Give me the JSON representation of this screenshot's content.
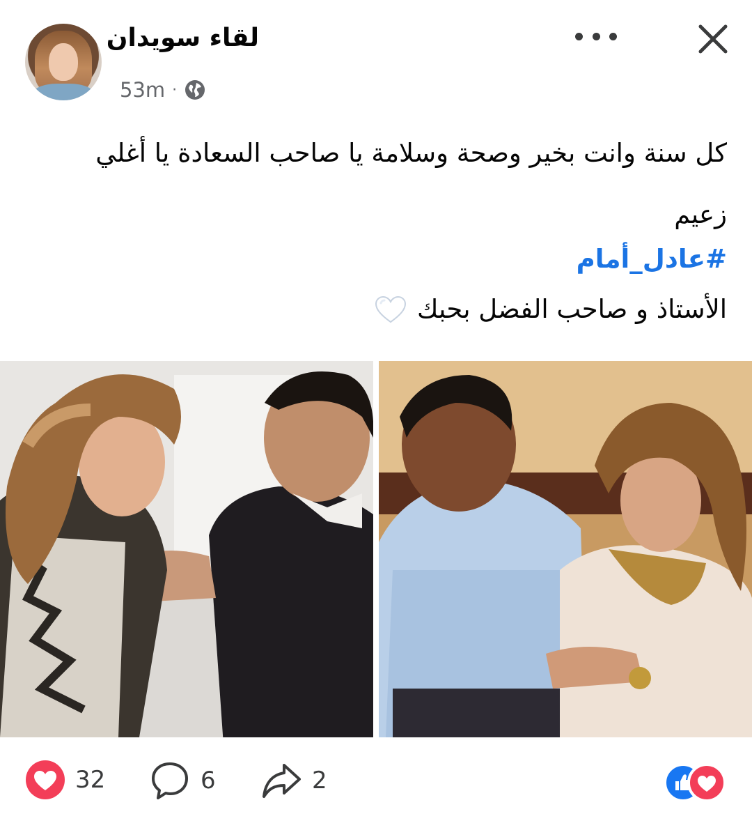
{
  "post": {
    "author_name": "لقاء سويدان",
    "time": "53m",
    "separator": "·",
    "text_lines": [
      "كل سنة وانت بخير وصحة وسلامة يا صاحب السعادة يا أغلي",
      "زعيم"
    ],
    "hashtag": "#عادل_أمام",
    "caption": "الأستاذ و صاحب الفضل بحبك"
  },
  "icons": {
    "privacy": "globe-icon",
    "menu": "more-horizontal-icon",
    "close": "close-icon",
    "caption_emoji": "white-heart-icon",
    "like": "heart-icon",
    "comment": "comment-icon",
    "share": "share-icon"
  },
  "footer": {
    "likes_count": "32",
    "comments_count": "6",
    "shares_count": "2"
  },
  "colors": {
    "hashtag": "#1b74e4",
    "like_red": "#f33e58",
    "like_blue": "#1877f2",
    "muted": "#65676b"
  }
}
